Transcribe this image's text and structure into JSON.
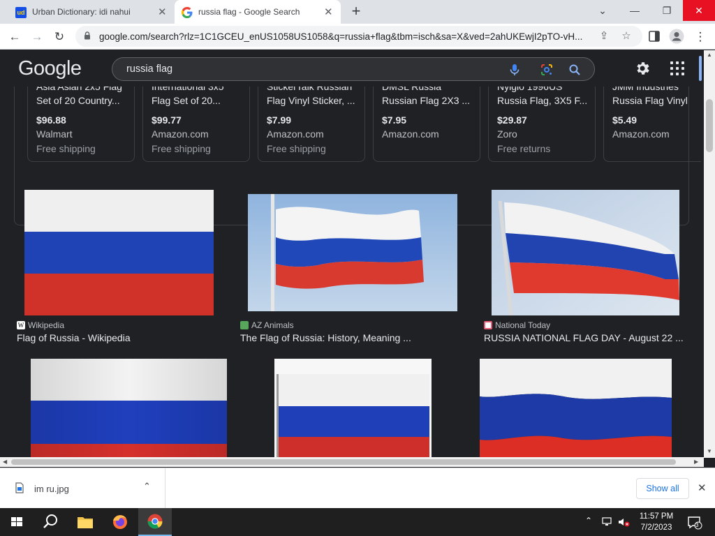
{
  "browser": {
    "tabs": [
      {
        "title": "Urban Dictionary: idi nahui",
        "active": false
      },
      {
        "title": "russia flag - Google Search",
        "active": true
      }
    ],
    "url": "google.com/search?rlz=1C1GCEU_enUS1058US1058&q=russia+flag&tbm=isch&sa=X&ved=2ahUKEwjI2pTO-vH..."
  },
  "google": {
    "logo": "Google",
    "query": "russia flag"
  },
  "shopping": [
    {
      "line1": "Asia Asian 2x5 Flag",
      "line2": "Set of 20 Country...",
      "price": "$96.88",
      "store": "Walmart",
      "shipping": "Free shipping"
    },
    {
      "line1": "International 3x5",
      "line2": "Flag Set of 20...",
      "price": "$99.77",
      "store": "Amazon.com",
      "shipping": "Free shipping"
    },
    {
      "line1": "StickerTalk Russian",
      "line2": "Flag Vinyl Sticker, ...",
      "price": "$7.99",
      "store": "Amazon.com",
      "shipping": "Free shipping"
    },
    {
      "line1": "DMSL Russia",
      "line2": "Russian Flag 2X3 ...",
      "price": "$7.95",
      "store": "Amazon.com",
      "shipping": ""
    },
    {
      "line1": "Nylglo 1996US",
      "line2": "Russia Flag, 3X5 F...",
      "price": "$29.87",
      "store": "Zoro",
      "shipping": "Free returns"
    },
    {
      "line1": "JMM Industries",
      "line2": "Russia Flag Vinyl",
      "price": "$5.49",
      "store": "Amazon.com",
      "shipping": ""
    }
  ],
  "results": [
    {
      "source": "Wikipedia",
      "title": "Flag of Russia - Wikipedia"
    },
    {
      "source": "AZ Animals",
      "title": "The Flag of Russia: History, Meaning ..."
    },
    {
      "source": "National Today",
      "title": "RUSSIA NATIONAL FLAG DAY - August 22 ..."
    }
  ],
  "colors": {
    "flag_white": "#f2f2f2",
    "flag_blue": "#1d3fb0",
    "flag_red": "#d3302b",
    "google_blue": "#8ab4f8",
    "close_red": "#e81123"
  },
  "download": {
    "filename": "im ru.jpg",
    "show_all": "Show all"
  },
  "taskbar": {
    "time": "11:57 PM",
    "date": "7/2/2023",
    "notifications": "3"
  }
}
